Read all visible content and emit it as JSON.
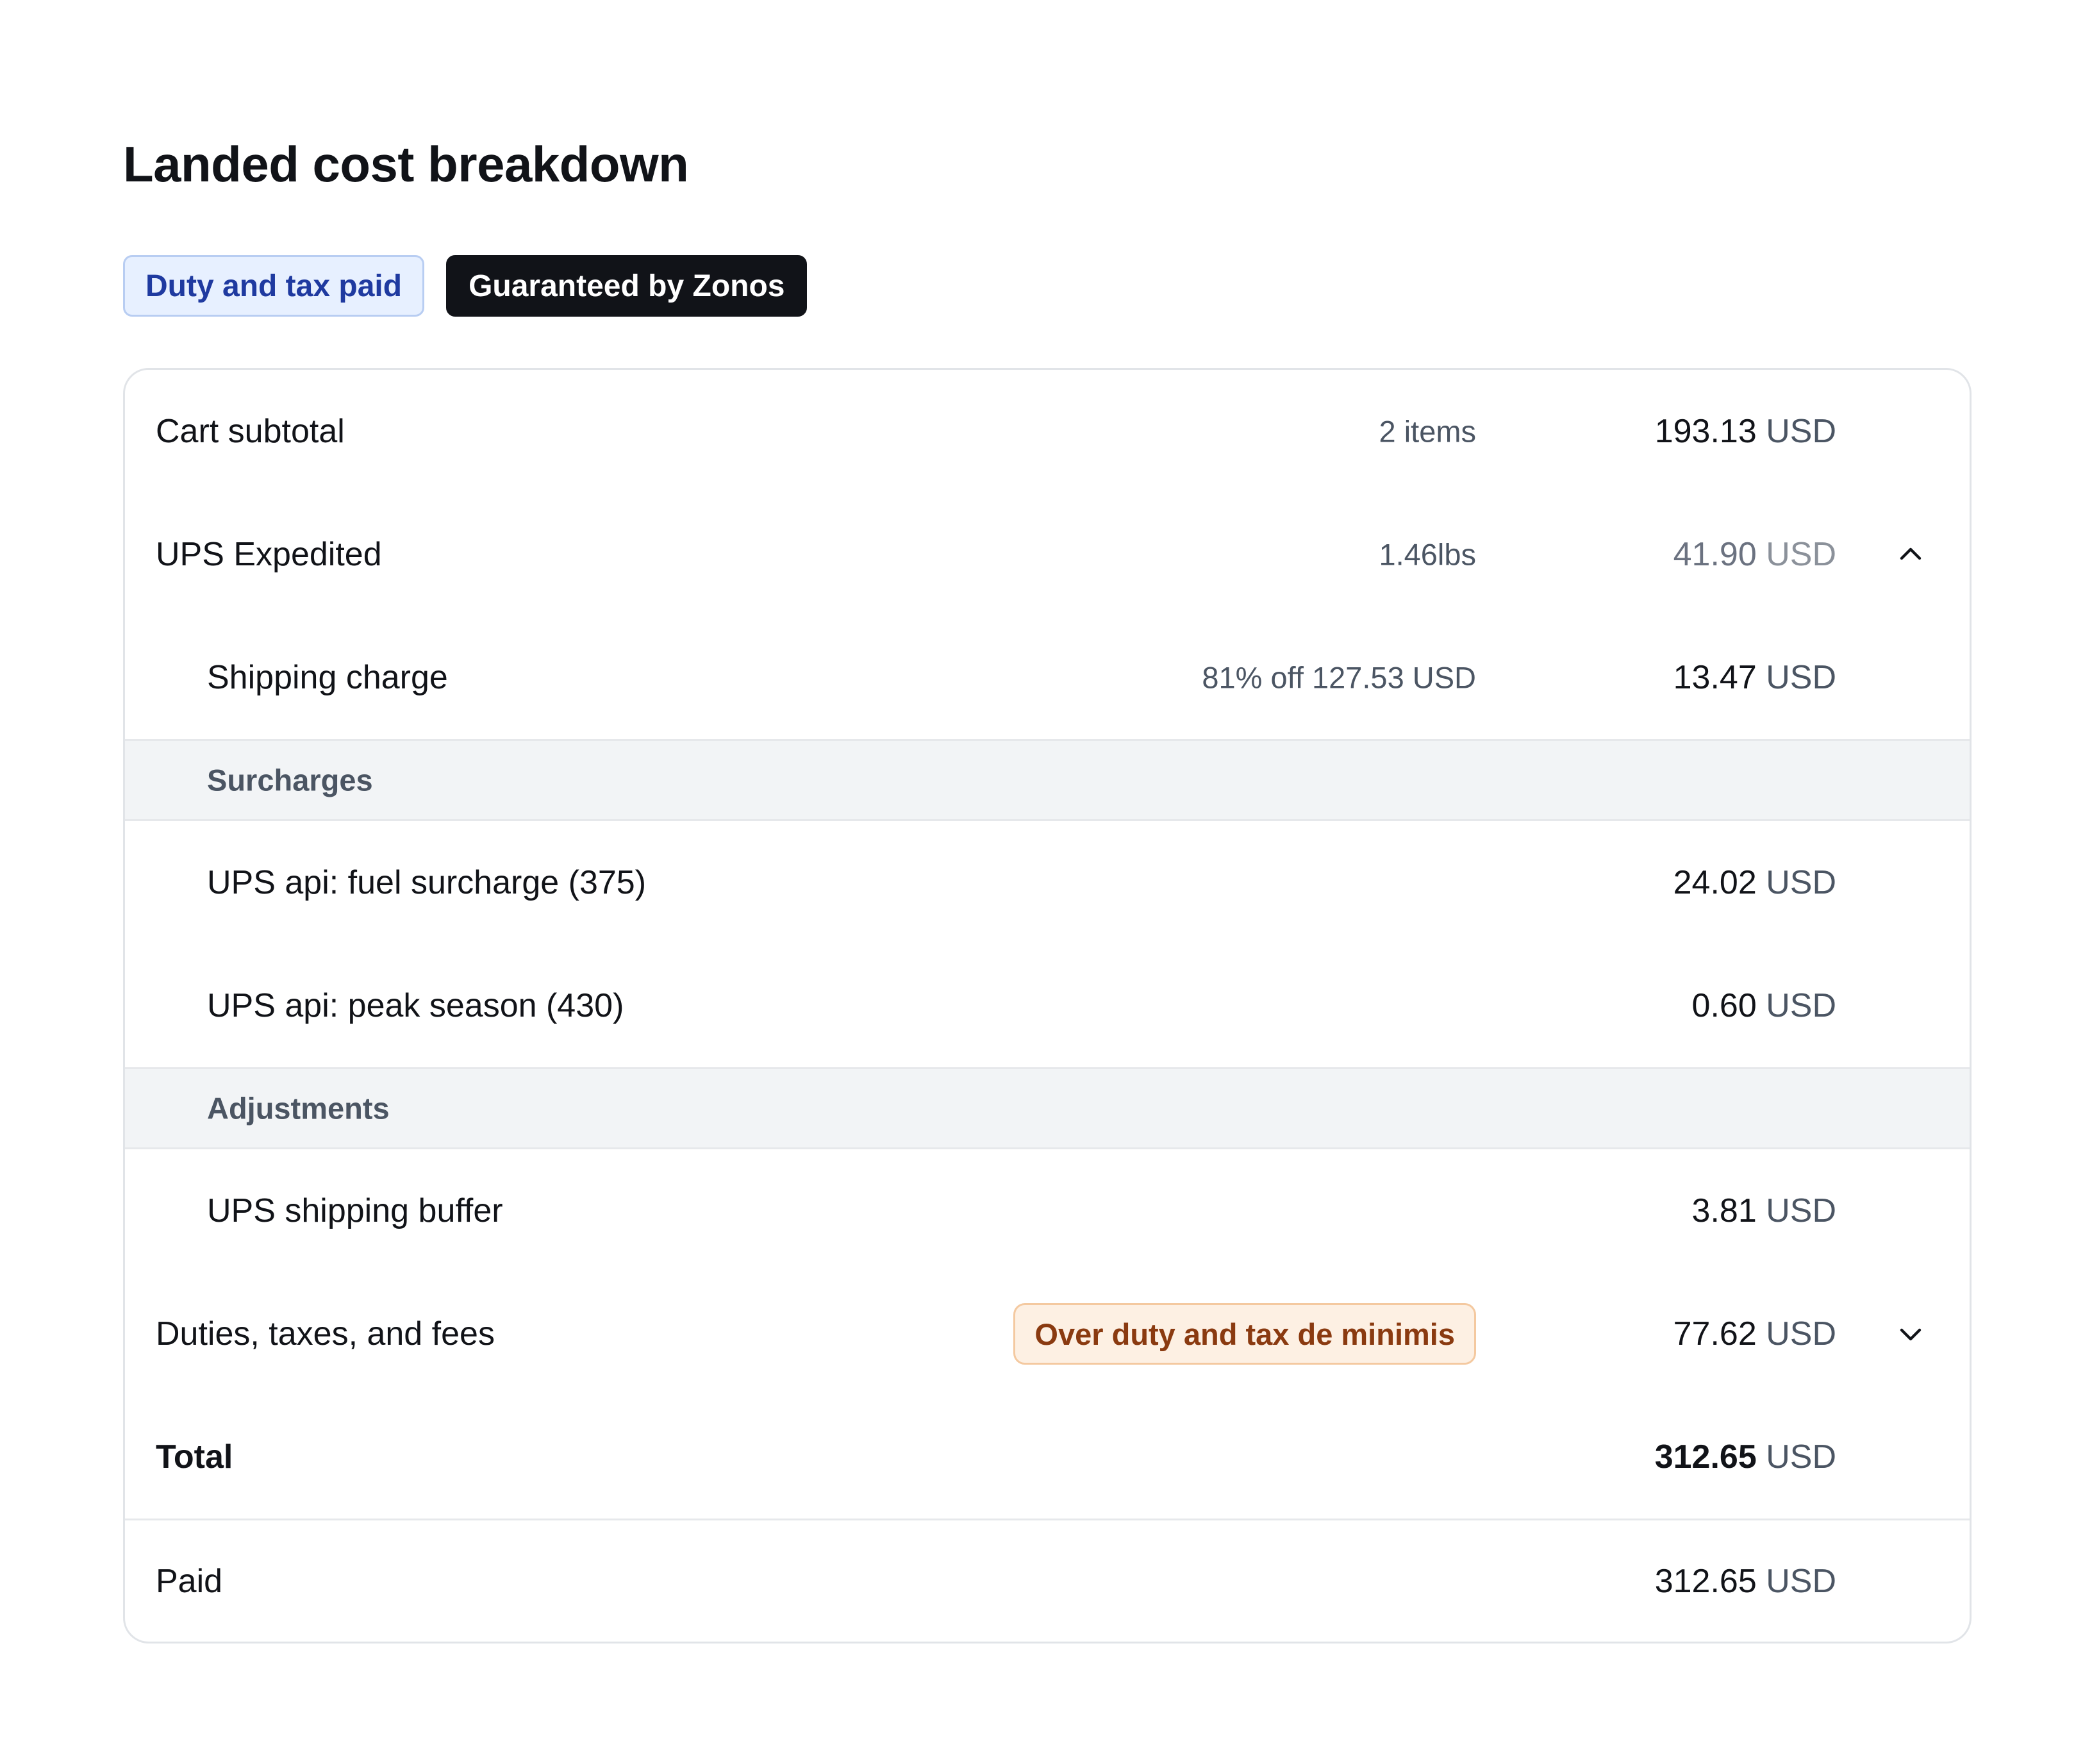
{
  "title": "Landed cost breakdown",
  "badges": {
    "duty_paid": "Duty and tax paid",
    "guaranteed": "Guaranteed by Zonos"
  },
  "rows": {
    "cart_subtotal": {
      "label": "Cart subtotal",
      "meta": "2 items",
      "amount": "193.13",
      "currency": "USD"
    },
    "ups_expedited": {
      "label": "UPS Expedited",
      "meta": "1.46lbs",
      "amount": "41.90",
      "currency": "USD",
      "expanded": true,
      "toggle_icon": "chevron-up-icon"
    },
    "shipping_charge": {
      "label": "Shipping charge",
      "meta": "81% off 127.53 USD",
      "amount": "13.47",
      "currency": "USD"
    },
    "surcharges_header": "Surcharges",
    "fuel_surcharge": {
      "label": "UPS api: fuel surcharge (375)",
      "amount": "24.02",
      "currency": "USD"
    },
    "peak_season": {
      "label": "UPS api: peak season (430)",
      "amount": "0.60",
      "currency": "USD"
    },
    "adjustments_header": "Adjustments",
    "shipping_buffer": {
      "label": "UPS shipping buffer",
      "amount": "3.81",
      "currency": "USD"
    },
    "duties": {
      "label": "Duties, taxes, and fees",
      "badge": "Over duty and tax de minimis",
      "amount": "77.62",
      "currency": "USD",
      "expanded": false,
      "toggle_icon": "chevron-down-icon"
    },
    "total": {
      "label": "Total",
      "amount": "312.65",
      "currency": "USD"
    },
    "paid": {
      "label": "Paid",
      "amount": "312.65",
      "currency": "USD"
    }
  },
  "colors": {
    "duty_badge_bg": "#e7f0ff",
    "duty_badge_text": "#1f3aa0",
    "guarantee_badge_bg": "#111318",
    "warning_badge_bg": "#fdf0e3",
    "warning_badge_text": "#8a3a10",
    "section_header_bg": "#f2f4f6"
  }
}
